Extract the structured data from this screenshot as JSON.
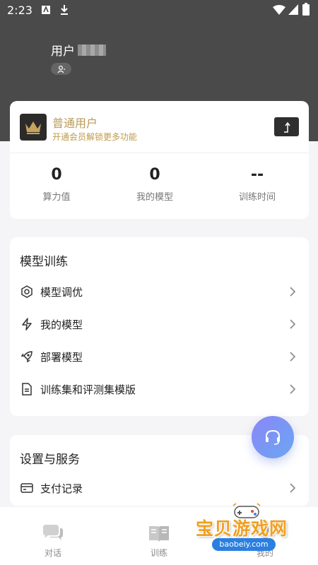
{
  "status_bar": {
    "time": "2:23"
  },
  "profile": {
    "name_prefix": "用户"
  },
  "member": {
    "title": "普通用户",
    "subtitle": "开通会员解锁更多功能",
    "stats": [
      {
        "value": "0",
        "label": "算力值"
      },
      {
        "value": "0",
        "label": "我的模型"
      },
      {
        "value": "--",
        "label": "训练时间"
      }
    ]
  },
  "training": {
    "title": "模型训练",
    "items": [
      {
        "label": "模型调优",
        "icon": "hexagon-settings-icon"
      },
      {
        "label": "我的模型",
        "icon": "lightning-icon"
      },
      {
        "label": "部署模型",
        "icon": "rocket-icon"
      },
      {
        "label": "训练集和评测集模版",
        "icon": "document-icon"
      }
    ]
  },
  "service": {
    "title": "设置与服务",
    "items": [
      {
        "label": "支付记录",
        "icon": "card-icon"
      }
    ]
  },
  "tabbar": {
    "tabs": [
      {
        "label": "对话",
        "icon": "chat-icon"
      },
      {
        "label": "训练",
        "icon": "book-icon"
      },
      {
        "label": "我的",
        "icon": "user-icon"
      }
    ]
  },
  "watermark": {
    "text": "宝贝游戏网",
    "url": "baobeiy.com"
  },
  "colors": {
    "header_bg": "#4a4a4a",
    "gold": "#b99a58",
    "fab_start": "#8a86f6",
    "fab_end": "#6aa7f2"
  }
}
